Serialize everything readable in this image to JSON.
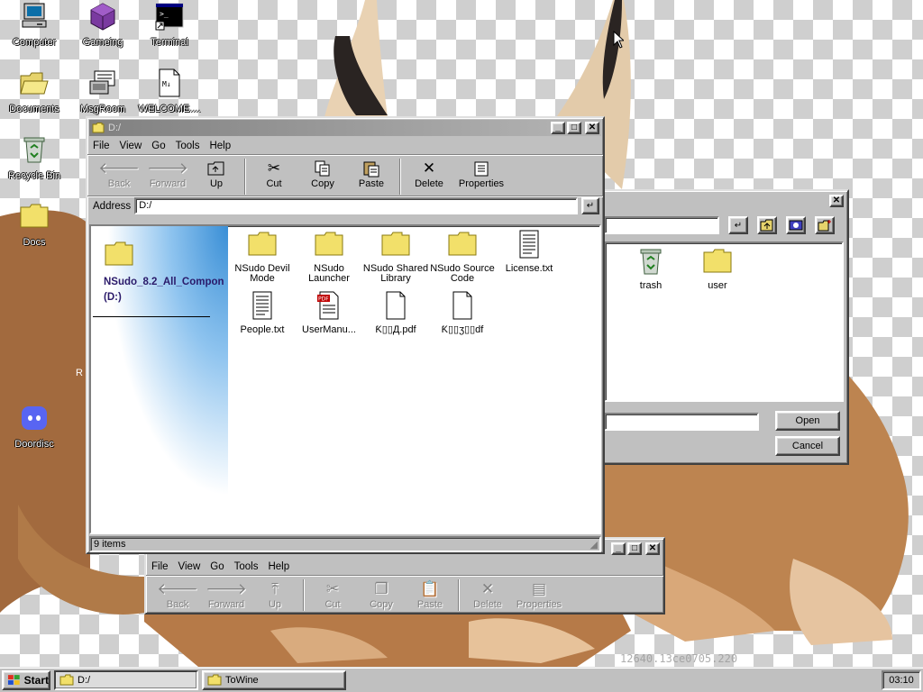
{
  "desktop": {
    "icons": [
      {
        "label": "Computer"
      },
      {
        "label": "Gameing"
      },
      {
        "label": "Terminal"
      },
      {
        "label": "Documents"
      },
      {
        "label": "MsgRoom"
      },
      {
        "label": "WELCOME...."
      },
      {
        "label": "Recycle Bin"
      },
      {
        "label": "Docs"
      },
      {
        "label": "Doordisc"
      }
    ],
    "partial_label": "R",
    "watermark": "12640.13ce0705.220"
  },
  "explorer": {
    "title": "D:/",
    "menu": [
      "File",
      "View",
      "Go",
      "Tools",
      "Help"
    ],
    "toolbar": {
      "back": "Back",
      "forward": "Forward",
      "up": "Up",
      "cut": "Cut",
      "copy": "Copy",
      "paste": "Paste",
      "delete": "Delete",
      "properties": "Properties"
    },
    "address_label": "Address",
    "address_value": "D:/",
    "sidebar_title": "NSudo_8.2_All_Compon",
    "sidebar_sub": "(D:)",
    "files": [
      {
        "name": "NSudo Devil Mode",
        "icon": "folder"
      },
      {
        "name": "NSudo Launcher",
        "icon": "folder"
      },
      {
        "name": "NSudo Shared Library",
        "icon": "folder"
      },
      {
        "name": "NSudo Source Code",
        "icon": "folder"
      },
      {
        "name": "License.txt",
        "icon": "text-file"
      },
      {
        "name": "People.txt",
        "icon": "text-file"
      },
      {
        "name": "UserManu...",
        "icon": "pdf-file"
      },
      {
        "name": "Ƙ▯▯Д.pdf",
        "icon": "blank-file"
      },
      {
        "name": "Ƙ▯▯ʒ▯▯df",
        "icon": "blank-file"
      }
    ],
    "status": "9 items"
  },
  "dialog": {
    "items": [
      {
        "name": "trash"
      },
      {
        "name": "user"
      }
    ],
    "open_label": "Open",
    "cancel_label": "Cancel"
  },
  "second_window": {
    "menu": [
      "File",
      "View",
      "Go",
      "Tools",
      "Help"
    ],
    "toolbar": {
      "back": "Back",
      "forward": "Forward",
      "up": "Up",
      "cut": "Cut",
      "copy": "Copy",
      "paste": "Paste",
      "delete": "Delete",
      "properties": "Properties"
    }
  },
  "taskbar": {
    "start_label": "Start",
    "tasks": [
      {
        "label": "D:/"
      },
      {
        "label": "ToWine"
      }
    ],
    "clock": "03:10"
  }
}
